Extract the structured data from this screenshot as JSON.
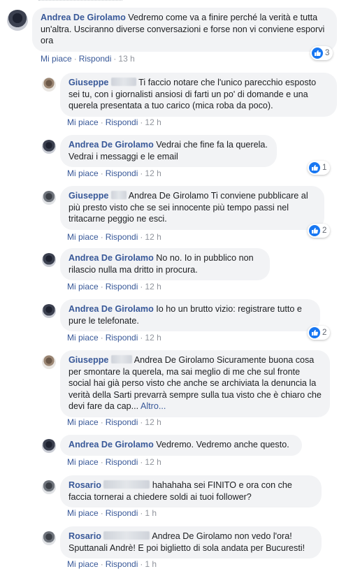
{
  "actions": {
    "like": "Mi piace",
    "reply": "Rispondi",
    "sep": "·"
  },
  "colors": {
    "author": "#385898",
    "like_badge": "#1877f2",
    "bubble": "#f2f3f5"
  },
  "comments": [
    {
      "author": "Andrea De Girolamo",
      "text": "Vedremo come va a finire perché la verità e tutta un'altra. Usciranno diverse conversazioni e forse non vi conviene esporvi ora",
      "time": "13 h",
      "reactions": "3",
      "reaction_icon": "like-icon"
    },
    {
      "author": "Giuseppe",
      "text": "Ti faccio notare che l'unico parecchio esposto sei tu, con i giornalisti ansiosi di farti un po' di domande e una querela presentata a tuo carico (mica roba da poco).",
      "time": "12 h"
    },
    {
      "author": "Andrea De Girolamo",
      "text": "Vedrai che fine fa la querela. Vedrai i messaggi e le email",
      "time": "12 h",
      "reactions": "1",
      "reaction_icon": "like-icon"
    },
    {
      "author": "Giuseppe",
      "text": "Andrea De Girolamo Ti conviene pubblicare al più presto visto che se sei innocente più tempo passi nel tritacarne peggio ne esci.",
      "time": "12 h",
      "reactions": "2",
      "reaction_icon": "like-icon"
    },
    {
      "author": "Andrea De Girolamo",
      "text": "No no. Io in pubblico non rilascio nulla ma dritto in procura.",
      "time": "12 h"
    },
    {
      "author": "Andrea De Girolamo",
      "text": "Io ho un brutto vizio: registrare tutto e pure le telefonate.",
      "time": "12 h",
      "reactions": "2",
      "reaction_icon": "like-icon"
    },
    {
      "author": "Giuseppe",
      "text": "Andrea De Girolamo Sicuramente buona cosa per smontare la querela, ma sai meglio di me che sul fronte social hai già perso visto che anche se archiviata la denuncia la verità della Sarti prevarrà sempre sulla tua visto che è chiaro che devi fare da cap...",
      "more": "Altro...",
      "time": "12 h"
    },
    {
      "author": "Andrea De Girolamo",
      "text": "Vedremo. Vedremo anche questo.",
      "time": "12 h"
    },
    {
      "author": "Rosario",
      "text": "hahahaha sei FINITO e ora con che faccia tornerai a chiedere soldi ai tuoi follower?",
      "time": "1 h"
    },
    {
      "author": "Rosario",
      "text": "Andrea De Girolamo non vedo l'ora! Sputtanali Andrè! E poi biglietto di sola andata per Bucuresti!",
      "time": "1 h"
    }
  ]
}
